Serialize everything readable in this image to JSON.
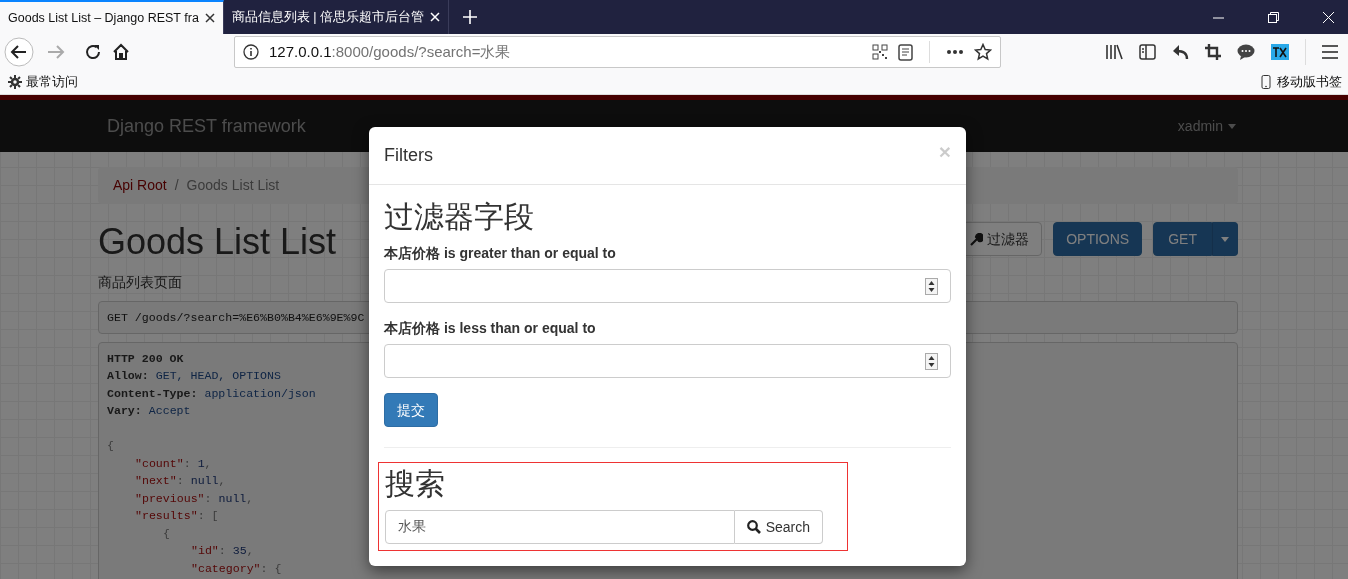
{
  "browser": {
    "tabs": [
      {
        "title": "Goods List List – Django REST fra",
        "selected": true
      },
      {
        "title": "商品信息列表 | 倍思乐超市后台管",
        "selected": false
      }
    ],
    "address": {
      "host": "127.0.0.1",
      "rest": ":8000/goods/?search=水果"
    },
    "bookmarks": [
      {
        "label": "最常访问",
        "kind": "most-visited"
      },
      {
        "label": "移动版书签",
        "kind": "mobile"
      }
    ]
  },
  "navbar": {
    "brand": "Django REST framework",
    "user": "xadmin"
  },
  "breadcrumb_separator": "/",
  "breadcrumb": [
    {
      "label": "Api Root",
      "selected": false
    },
    {
      "label": "Goods List List",
      "selected": true
    }
  ],
  "page": {
    "title": "Goods List List",
    "description": "商品列表页面",
    "buttons": [
      {
        "label": "过滤器",
        "kind": "filter"
      },
      {
        "label": "OPTIONS",
        "kind": "primary"
      },
      {
        "label": "GET",
        "kind": "split"
      }
    ],
    "request": "GET /goods/?search=%E6%B0%B4%E6%9E%9C",
    "response_headers": [
      {
        "key": "HTTP 200 OK"
      },
      {
        "key": "Allow:",
        "value": "GET, HEAD, OPTIONS"
      },
      {
        "key": "Content-Type:",
        "value": "application/json"
      },
      {
        "key": "Vary:",
        "value": "Accept"
      }
    ],
    "body": [
      {
        "tokens": [
          {
            "t": "{",
            "kind": "punct"
          }
        ],
        "children": [
          {
            "tokens": [
              {
                "t": "\"count\"",
                "kind": "key"
              },
              {
                "t": ": ",
                "kind": "punct"
              },
              {
                "t": "1",
                "kind": "value"
              },
              {
                "t": ",",
                "kind": "punct"
              }
            ]
          },
          {
            "tokens": [
              {
                "t": "\"next\"",
                "kind": "key"
              },
              {
                "t": ": ",
                "kind": "punct"
              },
              {
                "t": "null",
                "kind": "value"
              },
              {
                "t": ",",
                "kind": "punct"
              }
            ]
          },
          {
            "tokens": [
              {
                "t": "\"previous\"",
                "kind": "key"
              },
              {
                "t": ": ",
                "kind": "punct"
              },
              {
                "t": "null",
                "kind": "value"
              },
              {
                "t": ",",
                "kind": "punct"
              }
            ]
          },
          {
            "tokens": [
              {
                "t": "\"results\"",
                "kind": "key"
              },
              {
                "t": ": [",
                "kind": "punct"
              }
            ],
            "children": [
              {
                "tokens": [
                  {
                    "t": "{",
                    "kind": "punct"
                  }
                ],
                "children": [
                  {
                    "tokens": [
                      {
                        "t": "\"id\"",
                        "kind": "key"
                      },
                      {
                        "t": ": ",
                        "kind": "punct"
                      },
                      {
                        "t": "35",
                        "kind": "value"
                      },
                      {
                        "t": ",",
                        "kind": "punct"
                      }
                    ]
                  },
                  {
                    "tokens": [
                      {
                        "t": "\"category\"",
                        "kind": "key"
                      },
                      {
                        "t": ": {",
                        "kind": "punct"
                      }
                    ]
                  }
                ]
              }
            ]
          }
        ]
      }
    ]
  },
  "modal": {
    "title": "Filters",
    "close": "×",
    "heading": "过滤器字段",
    "fields": [
      {
        "label": "本店价格 is greater than or equal to"
      },
      {
        "label": "本店价格 is less than or equal to"
      }
    ],
    "submit": "提交",
    "search": {
      "heading": "搜索",
      "value": "水果",
      "button": "Search",
      "highlighted": true
    }
  }
}
